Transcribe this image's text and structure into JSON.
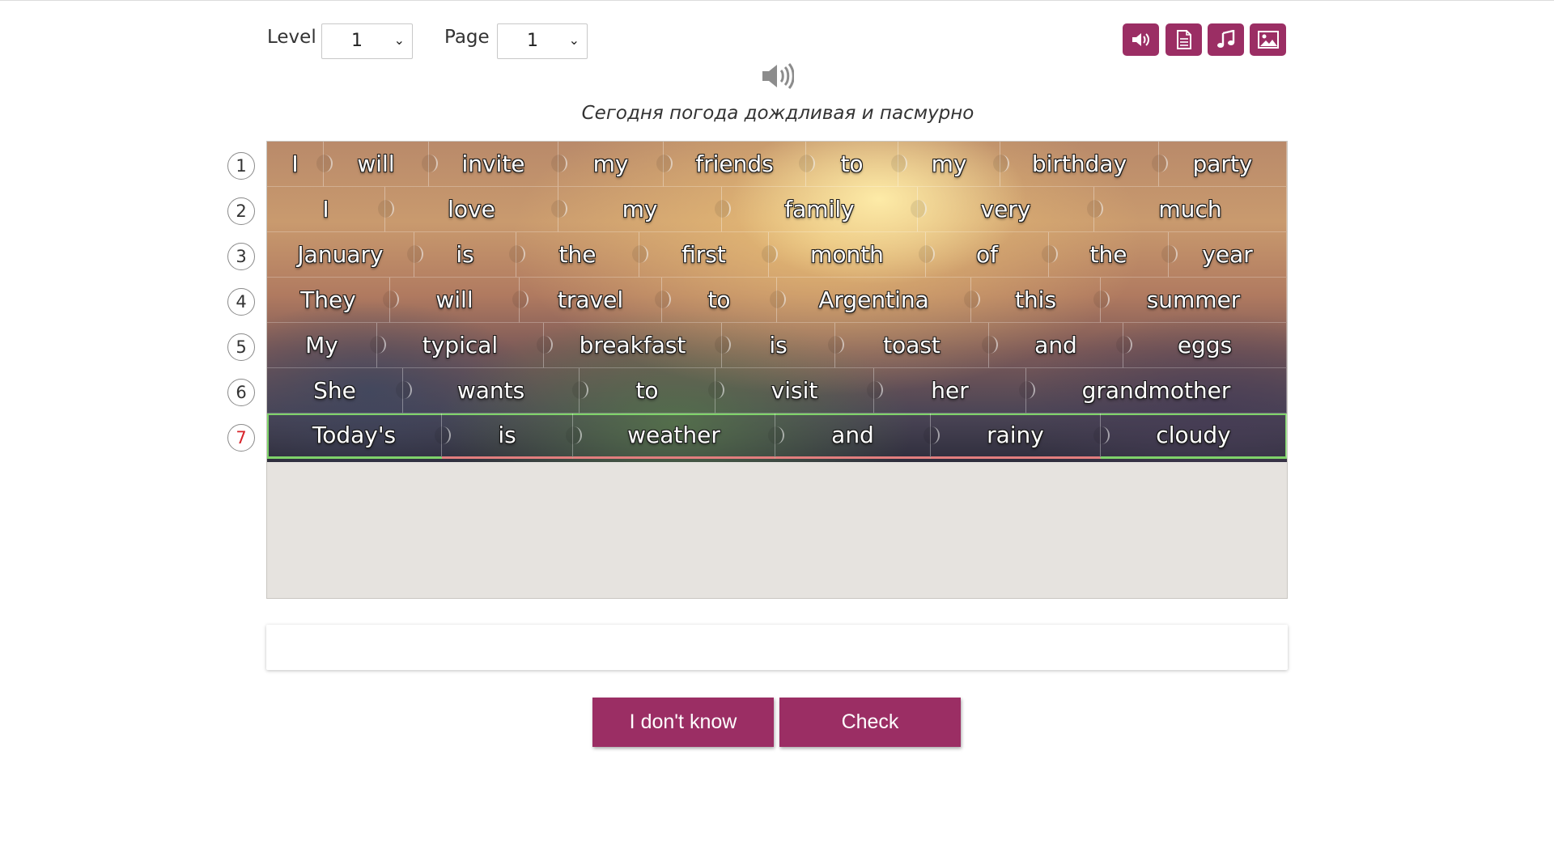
{
  "controls": {
    "level_label": "Level",
    "level_value": "1",
    "page_label": "Page",
    "page_value": "1"
  },
  "toolbar": {
    "icons": [
      "speaker-icon",
      "document-icon",
      "music-note-icon",
      "image-icon"
    ],
    "accent_color": "#9b2e64"
  },
  "translation": "Сегодня погода дождливая и пасмурно",
  "rows": [
    {
      "num": "1",
      "words": [
        "I",
        "will",
        "invite",
        "my",
        "friends",
        "to",
        "my",
        "birthday",
        "party"
      ]
    },
    {
      "num": "2",
      "words": [
        "I",
        "love",
        "my",
        "family",
        "very",
        "much"
      ]
    },
    {
      "num": "3",
      "words": [
        "January",
        "is",
        "the",
        "first",
        "month",
        "of",
        "the",
        "year"
      ]
    },
    {
      "num": "4",
      "words": [
        "They",
        "will",
        "travel",
        "to",
        "Argentina",
        "this",
        "summer"
      ]
    },
    {
      "num": "5",
      "words": [
        "My",
        "typical",
        "breakfast",
        "is",
        "toast",
        "and",
        "eggs"
      ]
    },
    {
      "num": "6",
      "words": [
        "She",
        "wants",
        "to",
        "visit",
        "her",
        "grandmother"
      ]
    },
    {
      "num": "7",
      "words": [
        "Today's",
        "is",
        "weather",
        "and",
        "rainy",
        "cloudy"
      ]
    }
  ],
  "buttons": {
    "dont_know": "I don't know",
    "check": "Check"
  }
}
